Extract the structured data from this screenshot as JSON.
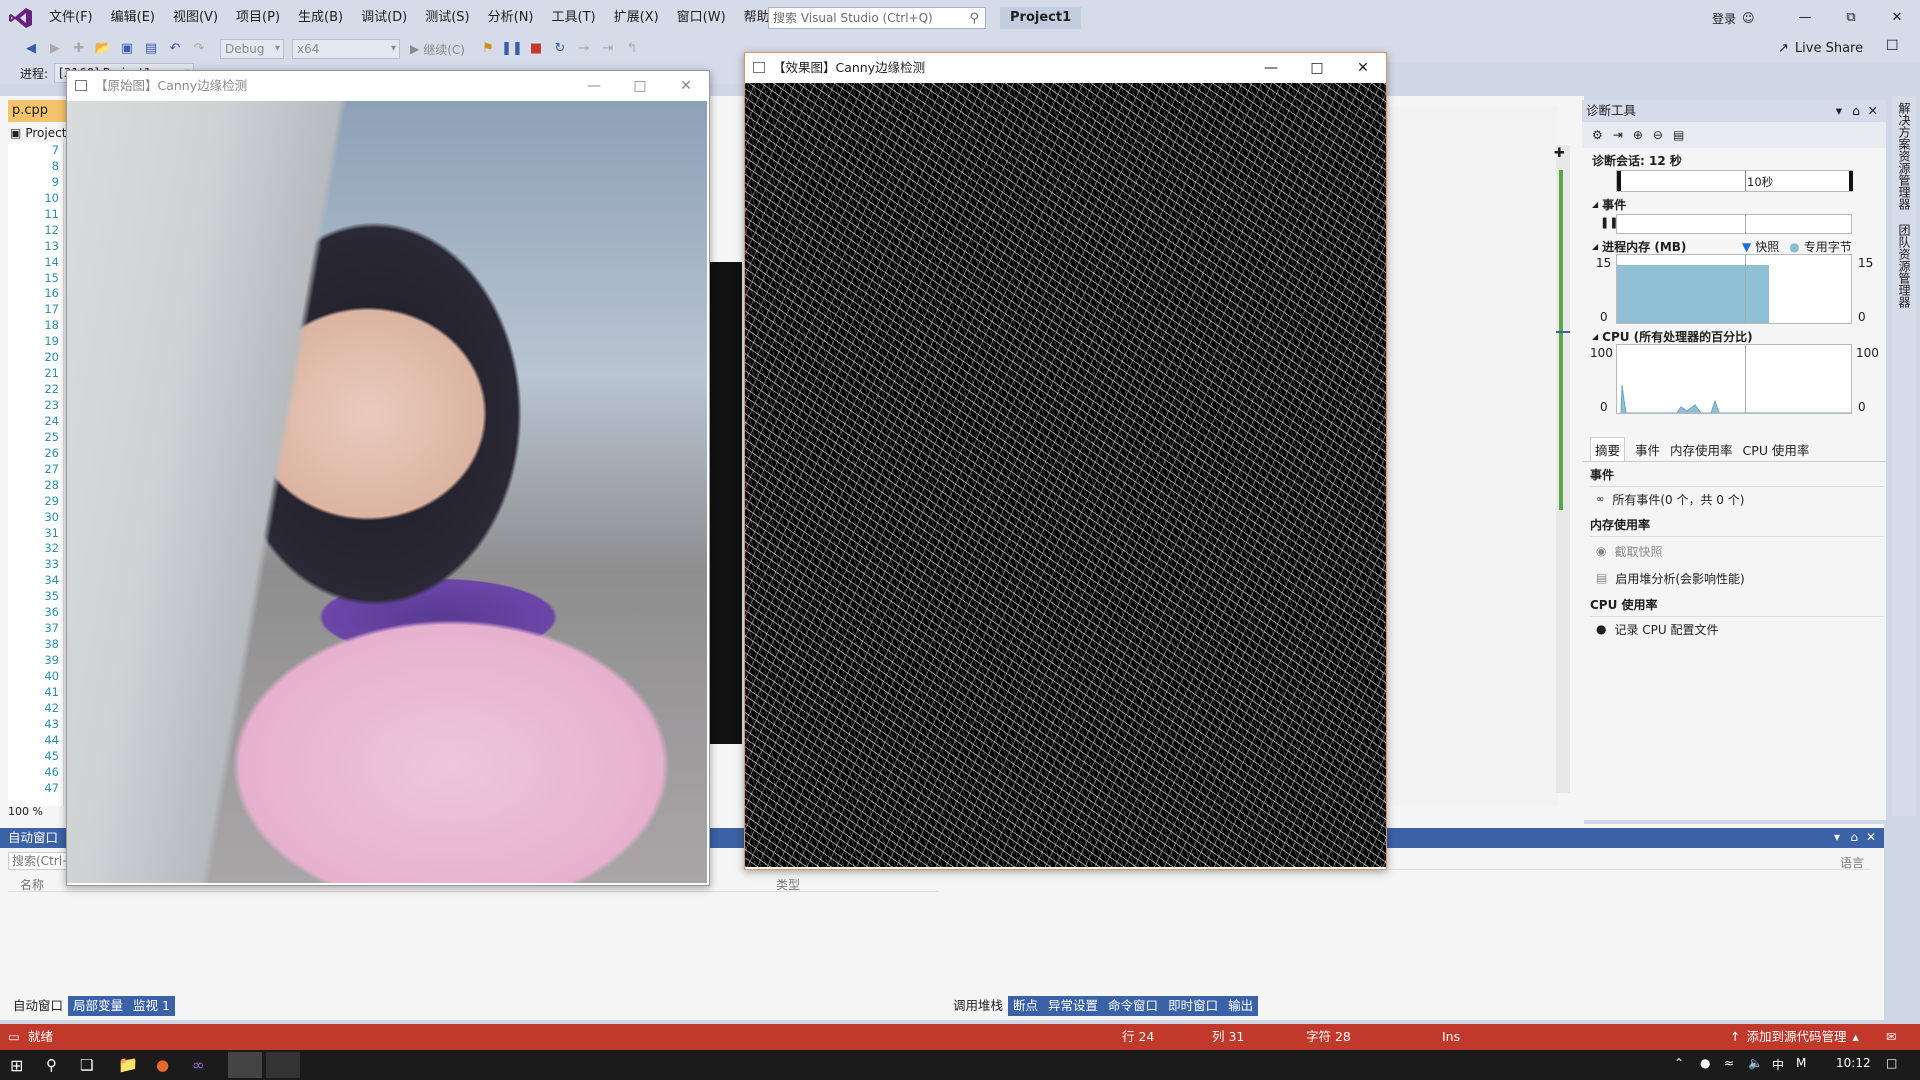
{
  "menubar": {
    "items": [
      "文件(F)",
      "编辑(E)",
      "视图(V)",
      "项目(P)",
      "生成(B)",
      "调试(D)",
      "测试(S)",
      "分析(N)",
      "工具(T)",
      "扩展(X)",
      "窗口(W)",
      "帮助(H)"
    ],
    "search_placeholder": "搜索 Visual Studio (Ctrl+Q)",
    "project_title": "Project1",
    "signin": "登录"
  },
  "toolbar": {
    "config": "Debug",
    "platform": "x64",
    "continue": "继续(C)",
    "live_share": "Live Share"
  },
  "row3": {
    "process_label": "进程:",
    "process_value": "[3160] Project1"
  },
  "editor": {
    "tab_label": "p.cpp",
    "solution_label": "Project",
    "line_numbers": [
      "7",
      "8",
      "9",
      "10",
      "11",
      "12",
      "13",
      "14",
      "15",
      "16",
      "17",
      "18",
      "19",
      "20",
      "21",
      "22",
      "23",
      "24",
      "25",
      "26",
      "27",
      "28",
      "29",
      "30",
      "31",
      "32",
      "33",
      "34",
      "35",
      "36",
      "37",
      "38",
      "39",
      "40",
      "41",
      "42",
      "43",
      "44",
      "45",
      "46",
      "47"
    ],
    "zoom": "100 %"
  },
  "diagnostics": {
    "title": "诊断工具",
    "session": "诊断会话: 12 秒",
    "timeline_label": "10秒",
    "events_label": "事件",
    "memory_label": "进程内存 (MB)",
    "snapshot_legend": "快照",
    "private_bytes_legend": "专用字节",
    "memory_max": "15",
    "memory_min": "0",
    "memory_fill": 0.86,
    "cpu_label": "CPU (所有处理器的百分比)",
    "cpu_max": "100",
    "cpu_min": "0",
    "tabs": [
      "摘要",
      "事件",
      "内存使用率",
      "CPU 使用率"
    ],
    "sec_events": "事件",
    "all_events": "所有事件(0 个，共 0 个)",
    "sec_memory": "内存使用率",
    "take_snapshot": "截取快照",
    "heap_analysis": "启用堆分析(会影响性能)",
    "sec_cpu": "CPU 使用率",
    "record_cpu": "记录 CPU 配置文件",
    "side_tabs": [
      "解决方案资源管理器",
      "团队资源管理器"
    ]
  },
  "autos": {
    "title": "自动窗口",
    "search_placeholder": "搜索(Ctrl+E)",
    "col_name": "名称",
    "col_type": "类型",
    "tabs": [
      "自动窗口",
      "局部变量",
      "监视 1"
    ]
  },
  "callstack": {
    "lang_col": "语言",
    "tabs": [
      "调用堆栈",
      "断点",
      "异常设置",
      "命令窗口",
      "即时窗口",
      "输出"
    ]
  },
  "statusbar": {
    "ready": "就绪",
    "row": "行 24",
    "col": "列 31",
    "char": "字符 28",
    "ins": "Ins",
    "source_control": "添加到源代码管理"
  },
  "taskbar": {
    "ime": "中",
    "time": "10:12"
  },
  "windows": {
    "original_title": "【原始图】Canny边缘检测",
    "effect_title": "【效果图】Canny边缘检测"
  },
  "colors": {
    "statusbar": "#c0392b",
    "panel_header": "#3b62a6",
    "accent_tab": "#f4c36b"
  }
}
